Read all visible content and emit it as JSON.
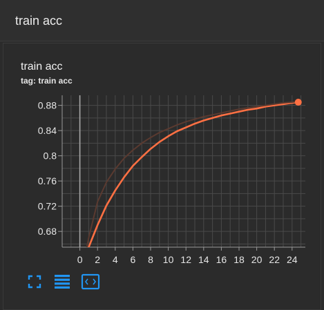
{
  "header": {
    "title": "train acc"
  },
  "card": {
    "title": "train acc",
    "tag_label": "tag:",
    "tag_value": "train acc"
  },
  "toolbar": [
    {
      "name": "fullscreen-icon"
    },
    {
      "name": "toggle-data-table-icon"
    },
    {
      "name": "fit-domain-icon"
    }
  ],
  "colors": {
    "smoothed": "#ff7043",
    "raw": "#5a3a30",
    "grid": "#4a4a4a",
    "axis": "#9a9a9a"
  },
  "chart_data": {
    "type": "line",
    "title": "",
    "xlabel": "",
    "ylabel": "",
    "xlim": [
      -2,
      25.5
    ],
    "ylim": [
      0.655,
      0.896
    ],
    "x_ticks": [
      "0",
      "2",
      "4",
      "6",
      "8",
      "10",
      "12",
      "14",
      "16",
      "18",
      "20",
      "22",
      "24"
    ],
    "y_ticks": [
      "0.68",
      "0.72",
      "0.76",
      "0.8",
      "0.84",
      "0.88"
    ],
    "grid": true,
    "series": [
      {
        "role": "smoothed",
        "x": [
          0.8,
          1,
          2,
          3,
          4,
          5,
          6,
          7,
          8,
          9,
          10,
          11,
          12,
          13,
          14,
          15,
          16,
          17,
          18,
          19,
          20,
          21,
          22,
          23,
          24,
          24.7
        ],
        "y": [
          0.643,
          0.655,
          0.69,
          0.721,
          0.745,
          0.766,
          0.784,
          0.798,
          0.811,
          0.822,
          0.831,
          0.839,
          0.845,
          0.851,
          0.856,
          0.86,
          0.864,
          0.867,
          0.87,
          0.873,
          0.875,
          0.878,
          0.88,
          0.882,
          0.884,
          0.885
        ]
      },
      {
        "role": "raw",
        "x": [
          0.8,
          1,
          2,
          3,
          4,
          5,
          6,
          7,
          8,
          9,
          10,
          11,
          12,
          13,
          14,
          15,
          16,
          17,
          18,
          19,
          20,
          21,
          22,
          23,
          24,
          24.7
        ],
        "y": [
          0.655,
          0.67,
          0.727,
          0.758,
          0.779,
          0.796,
          0.809,
          0.82,
          0.829,
          0.837,
          0.843,
          0.849,
          0.854,
          0.858,
          0.862,
          0.865,
          0.868,
          0.871,
          0.874,
          0.876,
          0.878,
          0.88,
          0.882,
          0.884,
          0.885,
          0.886
        ]
      }
    ]
  }
}
